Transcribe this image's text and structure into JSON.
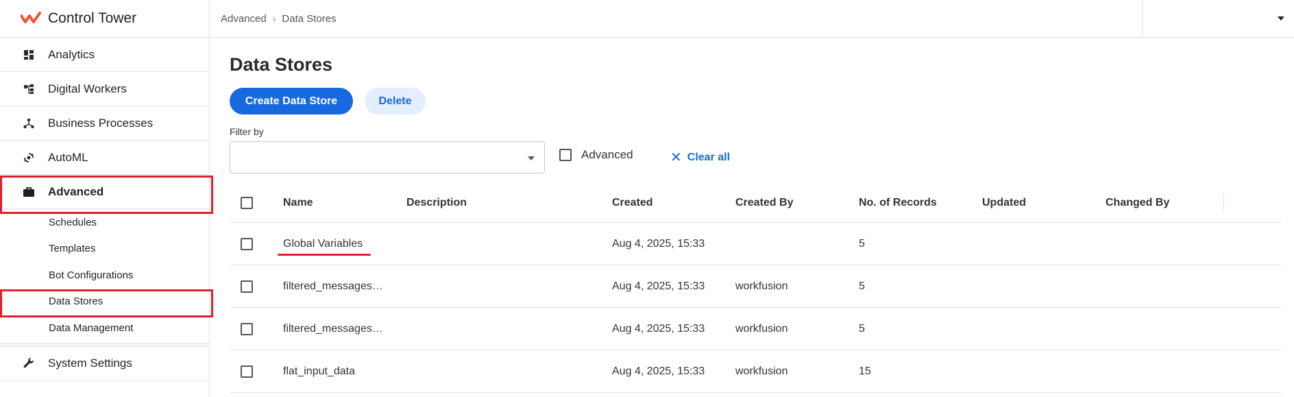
{
  "app": {
    "title": "Control Tower"
  },
  "sidebar": {
    "items": [
      {
        "label": "Analytics",
        "icon": "dashboard-icon"
      },
      {
        "label": "Digital Workers",
        "icon": "hierarchy-icon"
      },
      {
        "label": "Business Processes",
        "icon": "process-icon"
      },
      {
        "label": "AutoML",
        "icon": "automl-icon"
      },
      {
        "label": "Advanced",
        "icon": "briefcase-icon",
        "active": true
      }
    ],
    "sub_items": [
      "Schedules",
      "Templates",
      "Bot Configurations",
      "Data Stores",
      "Data Management"
    ],
    "bottom_item": {
      "label": "System Settings",
      "icon": "wrench-icon"
    }
  },
  "breadcrumb": {
    "parent": "Advanced",
    "current": "Data Stores"
  },
  "main": {
    "title": "Data Stores",
    "create_label": "Create Data Store",
    "delete_label": "Delete",
    "filter_label": "Filter by",
    "advanced_label": "Advanced",
    "clear_all_label": "Clear all"
  },
  "table": {
    "headers": {
      "name": "Name",
      "description": "Description",
      "created": "Created",
      "created_by": "Created By",
      "records": "No. of Records",
      "updated": "Updated",
      "changed_by": "Changed By"
    },
    "rows": [
      {
        "name": "Global Variables",
        "description": "",
        "created": "Aug 4, 2025, 15:33",
        "created_by": "",
        "records": "5",
        "updated": "",
        "changed_by": ""
      },
      {
        "name": "filtered_messages…",
        "description": "",
        "created": "Aug 4, 2025, 15:33",
        "created_by": "workfusion",
        "records": "5",
        "updated": "",
        "changed_by": ""
      },
      {
        "name": "filtered_messages…",
        "description": "",
        "created": "Aug 4, 2025, 15:33",
        "created_by": "workfusion",
        "records": "5",
        "updated": "",
        "changed_by": ""
      },
      {
        "name": "flat_input_data",
        "description": "",
        "created": "Aug 4, 2025, 15:33",
        "created_by": "workfusion",
        "records": "15",
        "updated": "",
        "changed_by": ""
      }
    ]
  },
  "colors": {
    "accent": "#1769e0",
    "highlight": "#e31d2b",
    "logo": "#f0532f"
  }
}
